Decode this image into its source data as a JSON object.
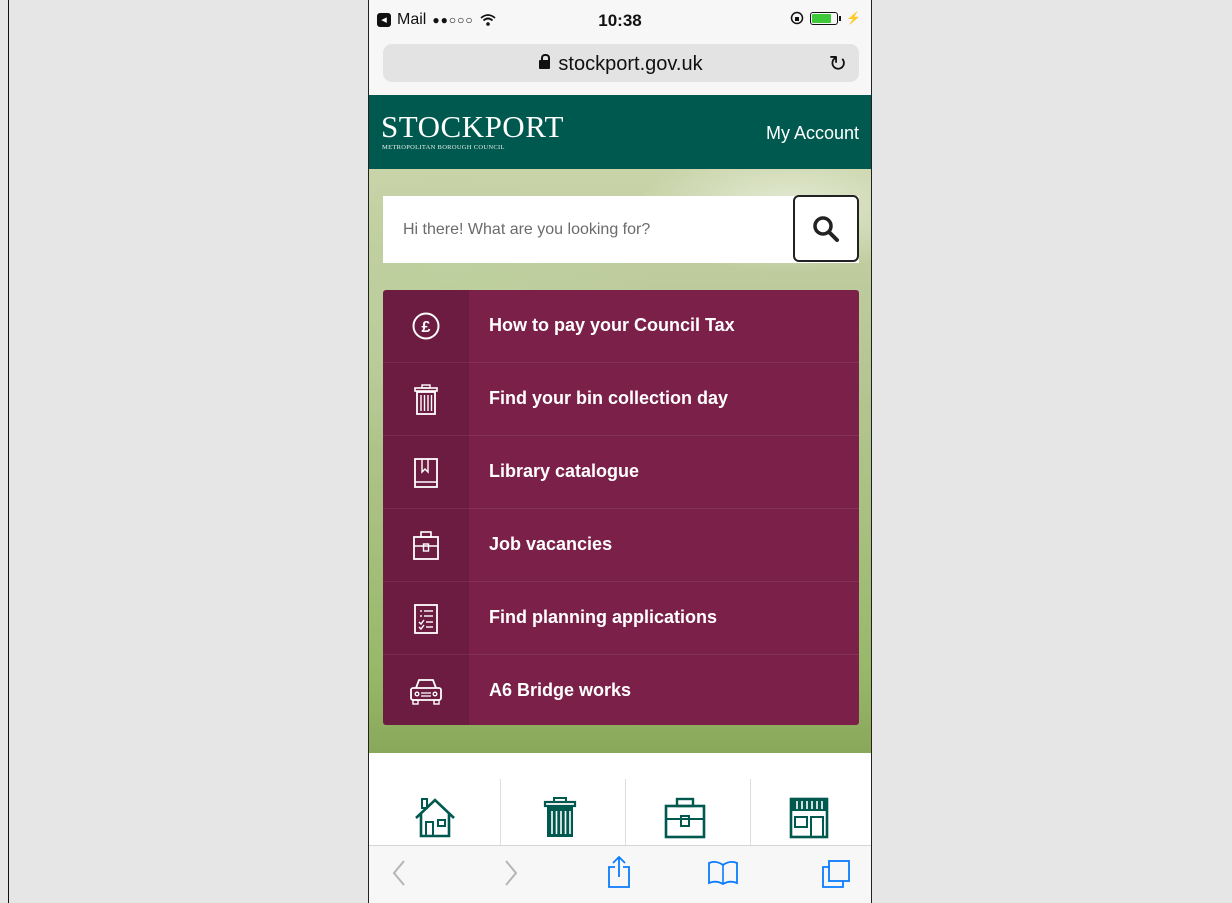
{
  "status_bar": {
    "back_app": "Mail",
    "signal": "●●○○○",
    "time": "10:38"
  },
  "browser": {
    "url": "stockport.gov.uk"
  },
  "header": {
    "logo_title": "STOCKPORT",
    "logo_subtitle": "METROPOLITAN BOROUGH COUNCIL",
    "account_link": "My Account",
    "brand_color": "#00594e"
  },
  "search": {
    "placeholder": "Hi there! What are you looking for?"
  },
  "quick_links": {
    "accent_color": "#7a2049",
    "items": [
      {
        "label": "How to pay your Council Tax",
        "icon": "pound-icon"
      },
      {
        "label": "Find your bin collection day",
        "icon": "bin-icon"
      },
      {
        "label": "Library catalogue",
        "icon": "book-icon"
      },
      {
        "label": "Job vacancies",
        "icon": "briefcase-icon"
      },
      {
        "label": "Find planning applications",
        "icon": "checklist-icon"
      },
      {
        "label": "A6 Bridge works",
        "icon": "car-icon"
      }
    ]
  },
  "tiles": [
    {
      "icon": "house-icon"
    },
    {
      "icon": "bin-icon"
    },
    {
      "icon": "briefcase-icon"
    },
    {
      "icon": "shop-icon"
    }
  ],
  "toolbar": {
    "icons": [
      "back-icon",
      "forward-icon",
      "share-icon",
      "bookmarks-icon",
      "tabs-icon"
    ]
  }
}
